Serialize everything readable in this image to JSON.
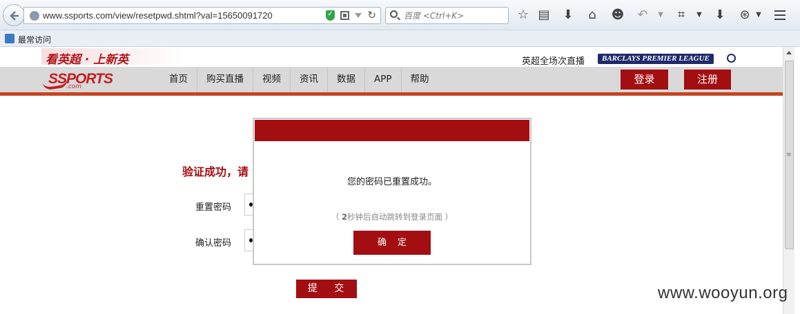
{
  "browser": {
    "url": "www.ssports.com/view/resetpwd.shtml?val=15650091720",
    "search_placeholder": "百度 <Ctrl+K>",
    "bookmark": "最常访问"
  },
  "header": {
    "slogan": "看英超 · 上新英",
    "epl_text": "英超全场次直播",
    "epl_logo": "BARCLAYS PREMIER LEAGUE",
    "logo": "SSPORTS",
    "logo_sub": ".com",
    "nav": [
      "首页",
      "购买直播",
      "视频",
      "资讯",
      "数据",
      "APP",
      "帮助"
    ],
    "login": "登录",
    "register": "注册"
  },
  "form": {
    "title": "验证成功，请",
    "reset_label": "重置密码",
    "confirm_label": "确认密码",
    "submit": "提 交"
  },
  "modal": {
    "message": "您的密码已重置成功。",
    "countdown_prefix": "（ ",
    "countdown_seconds": "2",
    "countdown_suffix": "秒钟后自动跳转到登录页面 ）",
    "confirm": "确 定"
  },
  "watermark": "www.wooyun.org",
  "colors": {
    "brand_red": "#a30e11",
    "nav_accent": "#c54420"
  }
}
